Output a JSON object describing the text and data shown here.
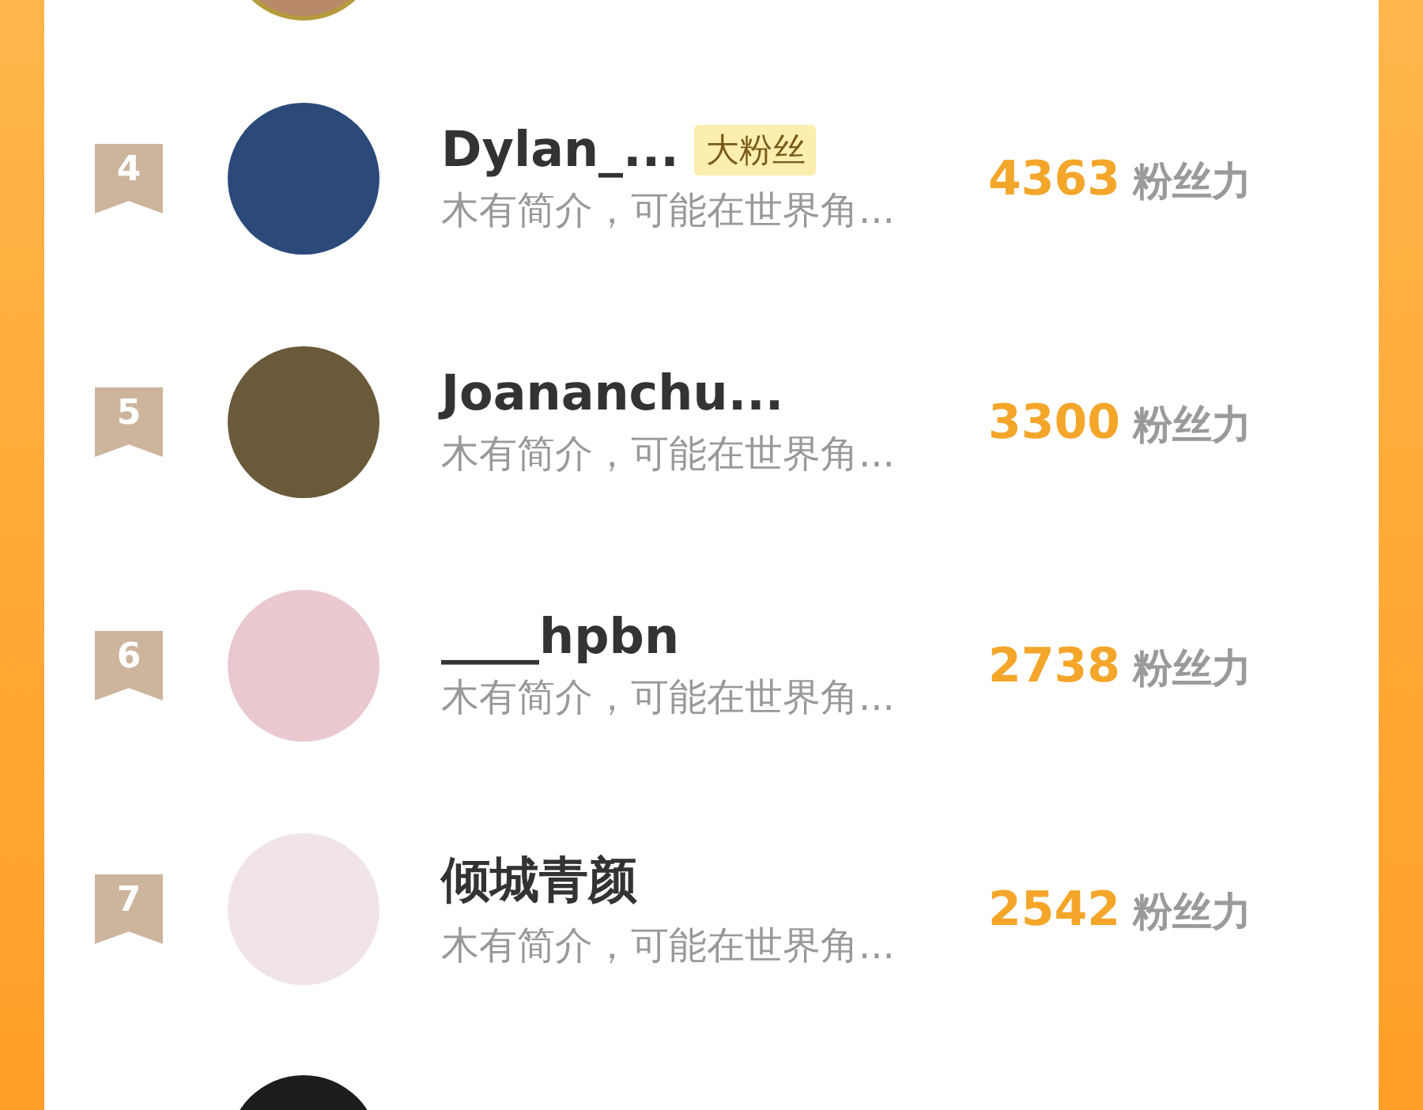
{
  "ranking": {
    "rows": [
      {
        "rank": "4",
        "name": "Dylan_...",
        "badge": "大粉丝",
        "bio": "木有简介，可能在世界角...",
        "score": "4363",
        "unit": "粉丝力"
      },
      {
        "rank": "5",
        "name": "Joananchu...",
        "bio": "木有简介，可能在世界角...",
        "score": "3300",
        "unit": "粉丝力"
      },
      {
        "rank": "6",
        "name": "____hpbn",
        "bio": "木有简介，可能在世界角...",
        "score": "2738",
        "unit": "粉丝力"
      },
      {
        "rank": "7",
        "name": "倾城青颜",
        "bio": "木有简介，可能在世界角...",
        "score": "2542",
        "unit": "粉丝力"
      }
    ]
  }
}
